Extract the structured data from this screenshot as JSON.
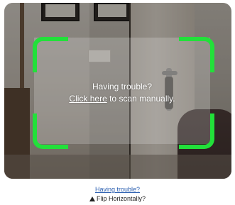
{
  "scanner": {
    "line1": "Having trouble?",
    "link_text": "Click here",
    "line2_suffix": " to scan manually."
  },
  "footer": {
    "trouble_link": "Having trouble?",
    "flip_label": "Flip Horizontally?",
    "flip_icon": "warning-icon"
  },
  "colors": {
    "scan_corner": "#22e03a",
    "link": "#2b5fb0"
  }
}
